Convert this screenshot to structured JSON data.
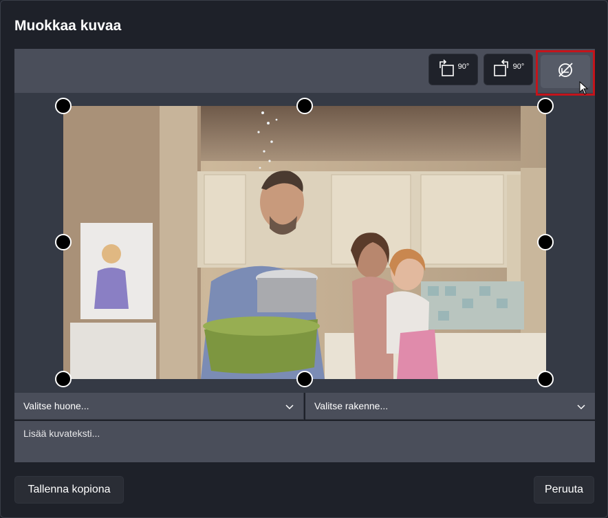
{
  "dialog": {
    "title": "Muokkaa kuvaa"
  },
  "toolbar": {
    "rotate_left_label": "90°",
    "rotate_right_label": "90°",
    "reset_icon": "reset-crop-icon"
  },
  "form": {
    "room_select_placeholder": "Valitse huone...",
    "structure_select_placeholder": "Valitse rakenne...",
    "caption_placeholder": "Lisää kuvateksti..."
  },
  "footer": {
    "save_copy_label": "Tallenna kopiona",
    "cancel_label": "Peruuta"
  },
  "colors": {
    "background": "#1e2129",
    "toolbar": "#4a4e5a",
    "highlight": "#c4141b"
  }
}
